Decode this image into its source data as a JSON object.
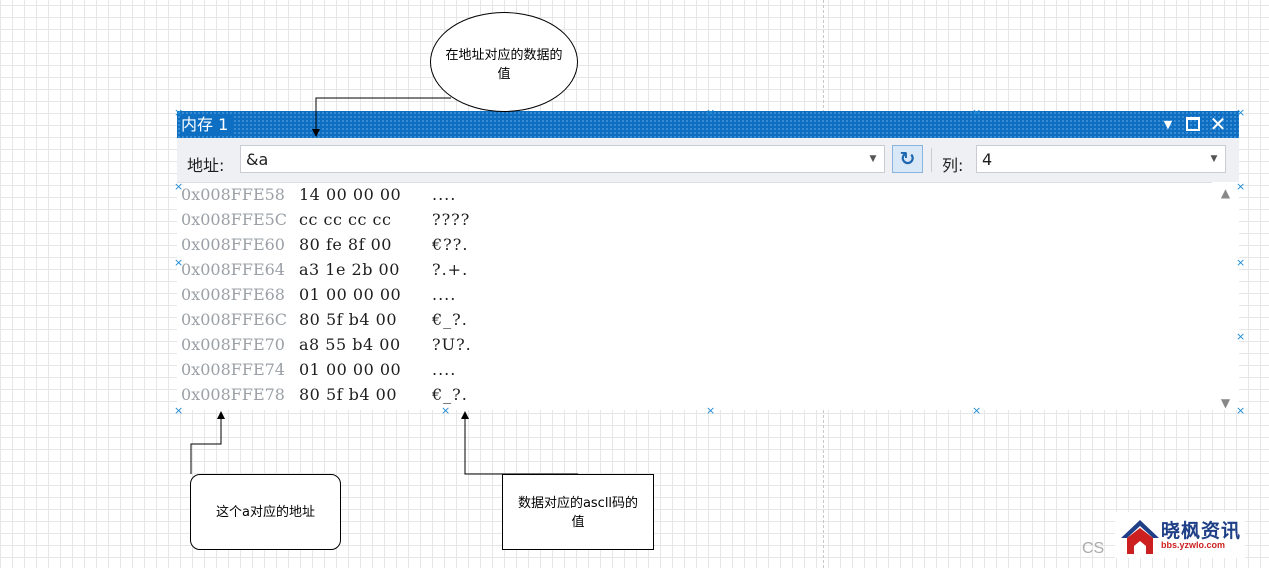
{
  "memory_window": {
    "title": "内存 1",
    "toolbar": {
      "address_label": "地址:",
      "address_value": "&a",
      "columns_label": "列:",
      "columns_value": "4"
    },
    "rows": [
      {
        "address": "0x008FFE58",
        "bytes": "14 00 00 00",
        "ascii": "...."
      },
      {
        "address": "0x008FFE5C",
        "bytes": "cc cc cc cc",
        "ascii": "????"
      },
      {
        "address": "0x008FFE60",
        "bytes": "80 fe 8f 00",
        "ascii": "€??."
      },
      {
        "address": "0x008FFE64",
        "bytes": "a3 1e 2b 00",
        "ascii": "?.+."
      },
      {
        "address": "0x008FFE68",
        "bytes": "01 00 00 00",
        "ascii": "...."
      },
      {
        "address": "0x008FFE6C",
        "bytes": "80 5f b4 00",
        "ascii": "€_?."
      },
      {
        "address": "0x008FFE70",
        "bytes": "a8 55 b4 00",
        "ascii": "?U?."
      },
      {
        "address": "0x008FFE74",
        "bytes": "01 00 00 00",
        "ascii": "...."
      },
      {
        "address": "0x008FFE78",
        "bytes": "80 5f b4 00",
        "ascii": "€_?."
      }
    ]
  },
  "annotations": {
    "data_value_line1": "在地址对应的数据的",
    "data_value_line2": "值",
    "address_note": "这个a对应的地址",
    "ascii_line1": "数据对应的ascll码的",
    "ascii_line2": "值"
  },
  "watermark": {
    "cs": "CS",
    "logo_name": "晓枫资讯",
    "logo_url": "bbs.yzwlo.com"
  }
}
